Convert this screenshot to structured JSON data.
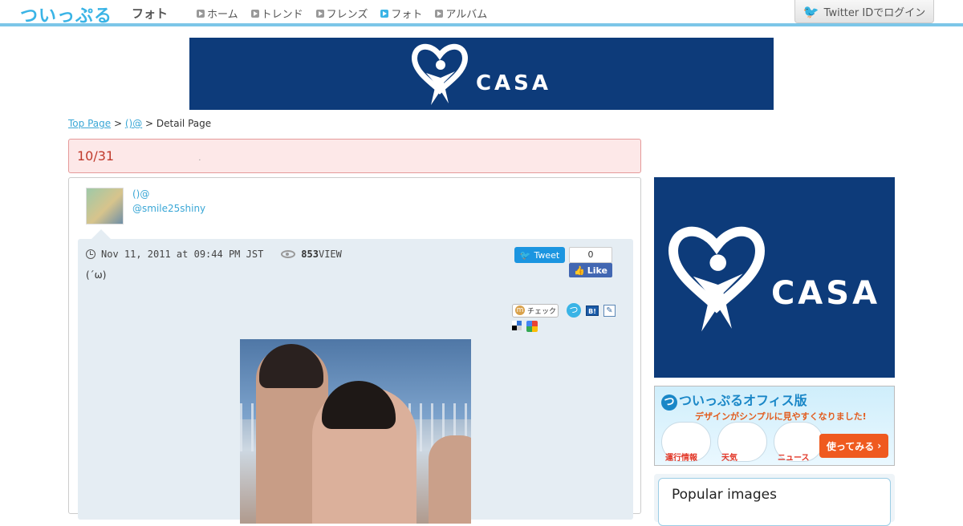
{
  "header": {
    "logo": "ついっぷる",
    "section": "フォト",
    "nav": [
      {
        "label": "ホーム",
        "active": false
      },
      {
        "label": "トレンド",
        "active": false
      },
      {
        "label": "フレンズ",
        "active": false
      },
      {
        "label": "フォト",
        "active": true
      },
      {
        "label": "アルバム",
        "active": false
      }
    ],
    "login_label": "Twitter IDでログイン"
  },
  "ads": {
    "brand": "CASA",
    "brand_color": "#0d3b7a"
  },
  "breadcrumb": {
    "home": "Top Page",
    "sep1": ">",
    "album": "()@",
    "sep2": "> Detail Page"
  },
  "title": "10/31",
  "title_dot": ".",
  "post": {
    "user_name": "()@",
    "user_handle": "@smile25shiny",
    "date": "Nov 11, 2011 at 09:44 PM JST",
    "views": "853",
    "views_label": "VIEW",
    "caption": "(´ω)",
    "tweet_label": "Tweet",
    "like_count": "0",
    "like_label": "Like",
    "mixi_label": "チェック",
    "hatena_label": "B!"
  },
  "sidebar": {
    "office_title": "ついっぷるオフィス版",
    "office_sub": "デザインがシンプルに見やすくなりました!",
    "office_items": [
      "運行情報",
      "天気",
      "ニュース"
    ],
    "try_label": "使ってみる",
    "popular_title": "Popular images"
  }
}
